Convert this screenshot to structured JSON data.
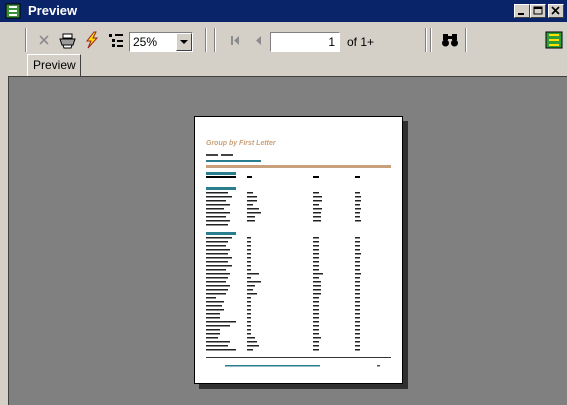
{
  "window": {
    "title": "Preview",
    "controls": [
      "minimize",
      "maximize",
      "close"
    ]
  },
  "toolbar": {
    "zoom": "25%",
    "page_number": "1",
    "page_of": "of 1+",
    "icons": [
      "close-icon",
      "print-icon",
      "export-lightning-icon",
      "group-tree-icon",
      "first-page-icon",
      "prev-page-icon",
      "search-binoculars-icon",
      "crystal-logo-icon"
    ]
  },
  "tabs": [
    {
      "label": "Preview"
    }
  ],
  "report": {
    "title": "Group by First Letter"
  },
  "colors": {
    "titlebar": "#0a246a",
    "accent_tan": "#c8a07c",
    "accent_teal": "#2a7f8f",
    "workspace": "#808080"
  }
}
